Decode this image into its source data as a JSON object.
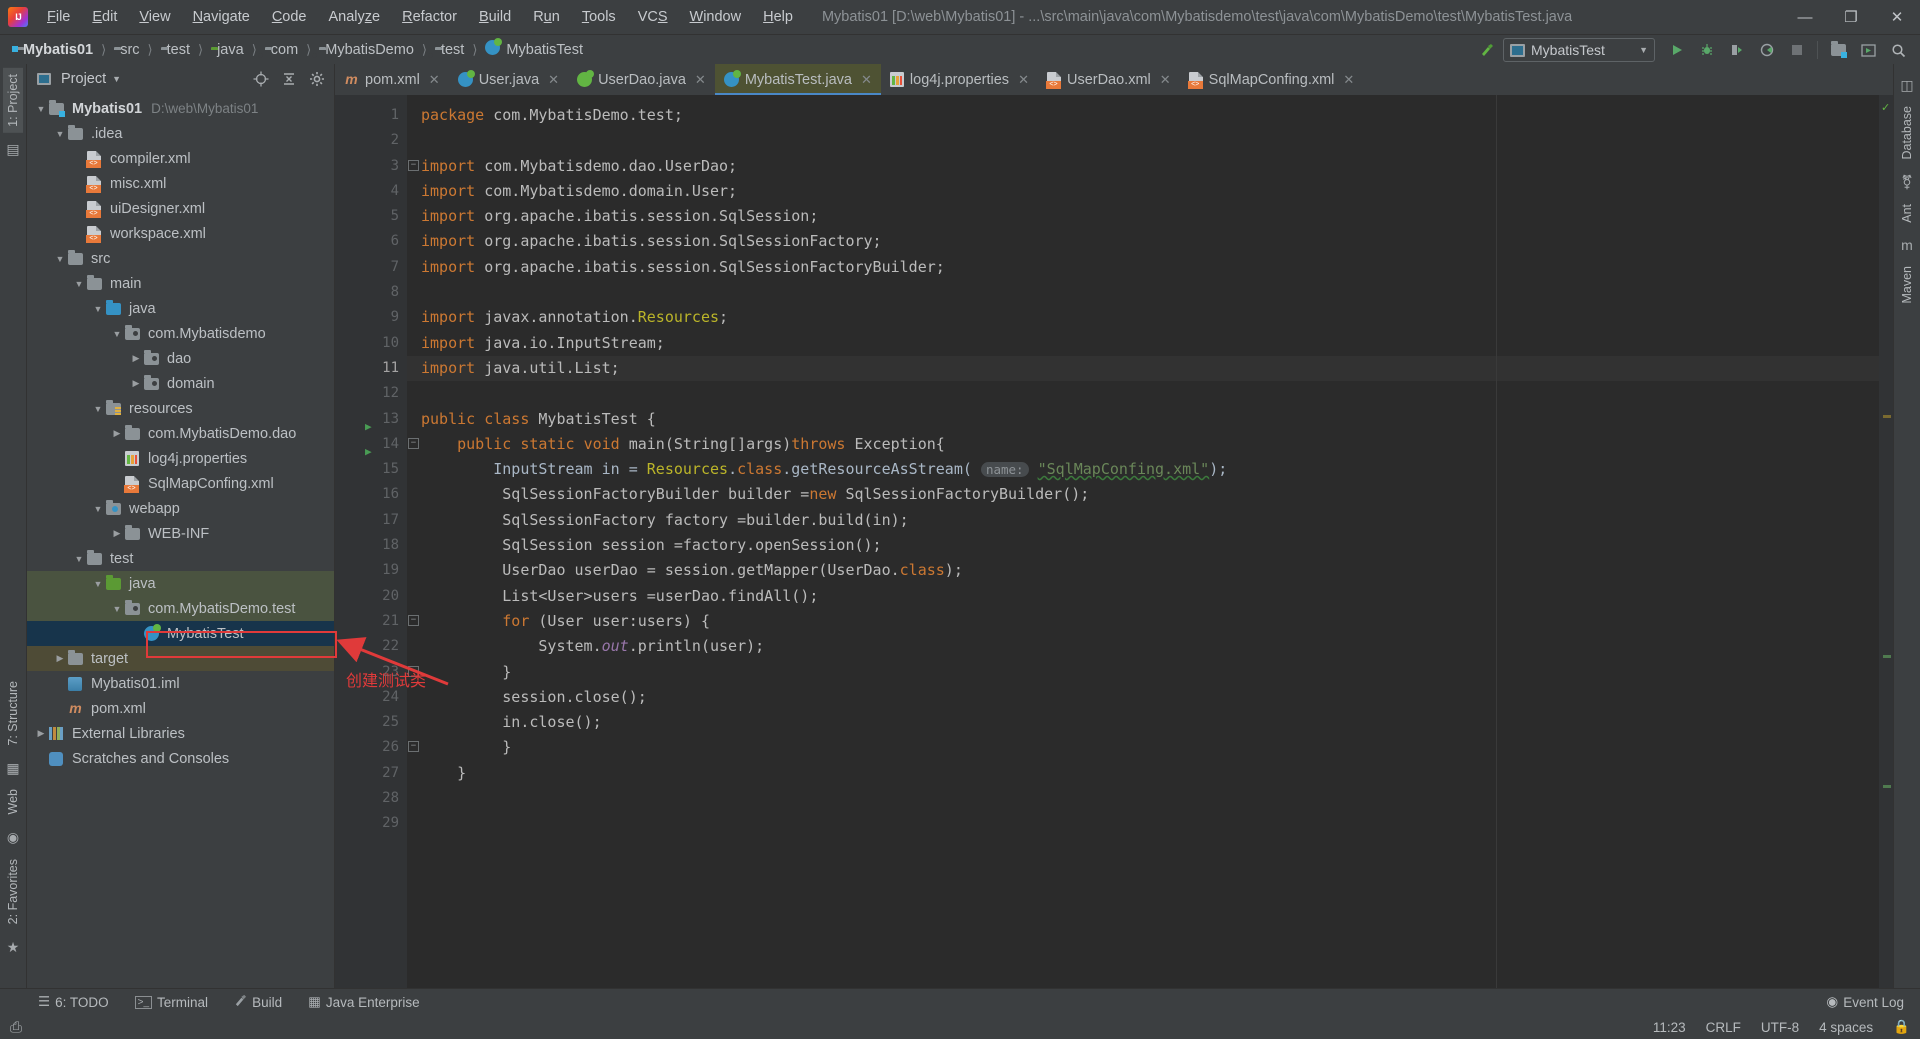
{
  "window": {
    "title": "Mybatis01 [D:\\web\\Mybatis01] - ...\\src\\main\\java\\com\\Mybatisdemo\\test\\java\\com\\MybatisDemo\\test\\MybatisTest.java",
    "minimize": "—",
    "maximize": "❐",
    "close": "✕"
  },
  "menu": [
    {
      "label": "File"
    },
    {
      "label": "Edit"
    },
    {
      "label": "View"
    },
    {
      "label": "Navigate"
    },
    {
      "label": "Code"
    },
    {
      "label": "Analyze"
    },
    {
      "label": "Refactor"
    },
    {
      "label": "Build"
    },
    {
      "label": "Run"
    },
    {
      "label": "Tools"
    },
    {
      "label": "VCS"
    },
    {
      "label": "Window"
    },
    {
      "label": "Help"
    }
  ],
  "breadcrumb": [
    {
      "label": "Mybatis01",
      "icon": "module-folder-icon"
    },
    {
      "label": "src",
      "icon": "folder-icon"
    },
    {
      "label": "test",
      "icon": "folder-icon"
    },
    {
      "label": "java",
      "icon": "source-root-folder-icon"
    },
    {
      "label": "com",
      "icon": "package-icon"
    },
    {
      "label": "MybatisDemo",
      "icon": "package-icon"
    },
    {
      "label": "test",
      "icon": "package-icon"
    },
    {
      "label": "MybatisTest",
      "icon": "java-class-icon"
    }
  ],
  "toolbar": {
    "build_hammer": "build-icon",
    "run_config": "MybatisTest",
    "run": "run-icon",
    "debug": "debug-icon",
    "run_coverage": "run-with-coverage-icon",
    "profile": "profile-icon",
    "stop": "stop-icon",
    "open_project": "open-project-icon",
    "update_project": "update-project-icon",
    "search": "search-everywhere-icon"
  },
  "left_strip": {
    "project_tab": "1: Project",
    "structure_tab": "7: Structure",
    "favorites_tab": "2: Favorites",
    "web_tab": "Web"
  },
  "right_strip": {
    "database_tab": "Database",
    "ant_tab": "Ant",
    "maven_tab": "Maven"
  },
  "project_panel": {
    "title": "Project",
    "dropdown": "▼",
    "locate_icon": "locate-target-icon",
    "collapse_icon": "collapse-all-icon",
    "settings_icon": "gear-icon",
    "tree": [
      {
        "depth": 0,
        "arrow": "down",
        "icon": "module-folder-icon",
        "label": "Mybatis01",
        "bold": true,
        "path": "D:\\web\\Mybatis01",
        "sel": ""
      },
      {
        "depth": 1,
        "arrow": "down",
        "icon": "folder-icon",
        "label": ".idea",
        "sel": ""
      },
      {
        "depth": 2,
        "arrow": "none",
        "icon": "xml-icon",
        "label": "compiler.xml",
        "sel": ""
      },
      {
        "depth": 2,
        "arrow": "none",
        "icon": "xml-icon",
        "label": "misc.xml",
        "sel": ""
      },
      {
        "depth": 2,
        "arrow": "none",
        "icon": "xml-icon",
        "label": "uiDesigner.xml",
        "sel": ""
      },
      {
        "depth": 2,
        "arrow": "none",
        "icon": "xml-icon",
        "label": "workspace.xml",
        "sel": ""
      },
      {
        "depth": 1,
        "arrow": "down",
        "icon": "folder-icon",
        "label": "src",
        "sel": ""
      },
      {
        "depth": 2,
        "arrow": "down",
        "icon": "folder-icon",
        "label": "main",
        "sel": ""
      },
      {
        "depth": 3,
        "arrow": "down",
        "icon": "source-root-blue-icon",
        "label": "java",
        "sel": ""
      },
      {
        "depth": 4,
        "arrow": "down",
        "icon": "package-icon",
        "label": "com.Mybatisdemo",
        "sel": ""
      },
      {
        "depth": 5,
        "arrow": "right",
        "icon": "package-icon",
        "label": "dao",
        "sel": ""
      },
      {
        "depth": 5,
        "arrow": "right",
        "icon": "package-icon",
        "label": "domain",
        "sel": ""
      },
      {
        "depth": 3,
        "arrow": "down",
        "icon": "resources-folder-icon",
        "label": "resources",
        "sel": ""
      },
      {
        "depth": 4,
        "arrow": "right",
        "icon": "folder-icon",
        "label": "com.MybatisDemo.dao",
        "sel": ""
      },
      {
        "depth": 4,
        "arrow": "none",
        "icon": "properties-icon",
        "label": "log4j.properties",
        "sel": ""
      },
      {
        "depth": 4,
        "arrow": "none",
        "icon": "xml-icon",
        "label": "SqlMapConfing.xml",
        "sel": ""
      },
      {
        "depth": 3,
        "arrow": "down",
        "icon": "webapp-folder-icon",
        "label": "webapp",
        "sel": ""
      },
      {
        "depth": 4,
        "arrow": "right",
        "icon": "folder-icon",
        "label": "WEB-INF",
        "sel": ""
      },
      {
        "depth": 2,
        "arrow": "down",
        "icon": "folder-icon",
        "label": "test",
        "sel": ""
      },
      {
        "depth": 3,
        "arrow": "down",
        "icon": "test-source-root-icon",
        "label": "java",
        "sel": "sel-green"
      },
      {
        "depth": 4,
        "arrow": "down",
        "icon": "package-icon",
        "label": "com.MybatisDemo.test",
        "sel": "sel-green"
      },
      {
        "depth": 5,
        "arrow": "none",
        "icon": "java-class-icon",
        "label": "MybatisTest",
        "sel": "sel-blue",
        "highlight": true
      },
      {
        "depth": 1,
        "arrow": "right",
        "icon": "target-folder-icon",
        "label": "target",
        "sel": "sel-olive"
      },
      {
        "depth": 1,
        "arrow": "none",
        "icon": "iml-icon",
        "label": "Mybatis01.iml",
        "sel": ""
      },
      {
        "depth": 1,
        "arrow": "none",
        "icon": "maven-icon",
        "label": "pom.xml",
        "sel": ""
      },
      {
        "depth": 0,
        "arrow": "right",
        "icon": "external-libraries-icon",
        "label": "External Libraries",
        "sel": ""
      },
      {
        "depth": 0,
        "arrow": "none",
        "icon": "scratches-icon",
        "label": "Scratches and Consoles",
        "sel": ""
      }
    ]
  },
  "editor": {
    "tabs": [
      {
        "label": "pom.xml",
        "icon": "maven-icon",
        "active": false
      },
      {
        "label": "User.java",
        "icon": "java-class-icon",
        "active": false
      },
      {
        "label": "UserDao.java",
        "icon": "java-interface-icon",
        "active": false
      },
      {
        "label": "MybatisTest.java",
        "icon": "java-class-icon",
        "active": true
      },
      {
        "label": "log4j.properties",
        "icon": "properties-icon",
        "active": false
      },
      {
        "label": "UserDao.xml",
        "icon": "xml-icon",
        "active": false
      },
      {
        "label": "SqlMapConfing.xml",
        "icon": "xml-icon",
        "active": false
      }
    ],
    "close_glyph": "✕",
    "lines": [
      {
        "n": 1,
        "hl": false,
        "fold": "",
        "run": false
      },
      {
        "n": 2,
        "hl": false,
        "fold": "",
        "run": false
      },
      {
        "n": 3,
        "hl": false,
        "fold": "minus-top",
        "run": false
      },
      {
        "n": 4,
        "hl": false,
        "fold": "",
        "run": false
      },
      {
        "n": 5,
        "hl": false,
        "fold": "",
        "run": false
      },
      {
        "n": 6,
        "hl": false,
        "fold": "",
        "run": false
      },
      {
        "n": 7,
        "hl": false,
        "fold": "",
        "run": false
      },
      {
        "n": 8,
        "hl": false,
        "fold": "",
        "run": false
      },
      {
        "n": 9,
        "hl": false,
        "fold": "",
        "run": false
      },
      {
        "n": 10,
        "hl": false,
        "fold": "",
        "run": false
      },
      {
        "n": 11,
        "hl": true,
        "fold": "minus-bottom",
        "run": false
      },
      {
        "n": 12,
        "hl": false,
        "fold": "",
        "run": false
      },
      {
        "n": 13,
        "hl": false,
        "fold": "",
        "run": true
      },
      {
        "n": 14,
        "hl": false,
        "fold": "minus-top",
        "run": true
      },
      {
        "n": 15,
        "hl": false,
        "fold": "",
        "run": false
      },
      {
        "n": 16,
        "hl": false,
        "fold": "",
        "run": false
      },
      {
        "n": 17,
        "hl": false,
        "fold": "",
        "run": false
      },
      {
        "n": 18,
        "hl": false,
        "fold": "",
        "run": false
      },
      {
        "n": 19,
        "hl": false,
        "fold": "",
        "run": false
      },
      {
        "n": 20,
        "hl": false,
        "fold": "",
        "run": false
      },
      {
        "n": 21,
        "hl": false,
        "fold": "minus-top",
        "run": false
      },
      {
        "n": 22,
        "hl": false,
        "fold": "",
        "run": false
      },
      {
        "n": 23,
        "hl": false,
        "fold": "minus-bottom",
        "run": false
      },
      {
        "n": 24,
        "hl": false,
        "fold": "",
        "run": false
      },
      {
        "n": 25,
        "hl": false,
        "fold": "",
        "run": false
      },
      {
        "n": 26,
        "hl": false,
        "fold": "minus-bottom",
        "run": false
      },
      {
        "n": 27,
        "hl": false,
        "fold": "",
        "run": false
      },
      {
        "n": 28,
        "hl": false,
        "fold": "",
        "run": false
      },
      {
        "n": 29,
        "hl": false,
        "fold": "",
        "run": false
      }
    ],
    "code_text": [
      "package com.MybatisDemo.test;",
      "",
      "import com.Mybatisdemo.dao.UserDao;",
      "import com.Mybatisdemo.domain.User;",
      "import org.apache.ibatis.session.SqlSession;",
      "import org.apache.ibatis.session.SqlSessionFactory;",
      "import org.apache.ibatis.session.SqlSessionFactoryBuilder;",
      "",
      "import javax.annotation.Resources;",
      "import java.io.InputStream;",
      "import java.util.List;",
      "",
      "public class MybatisTest {",
      "    public static void main(String[]args)throws Exception{",
      "        InputStream in = Resources.class.getResourceAsStream( name: \"SqlMapConfing.xml\");",
      "         SqlSessionFactoryBuilder builder =new SqlSessionFactoryBuilder();",
      "         SqlSessionFactory factory =builder.build(in);",
      "         SqlSession session =factory.openSession();",
      "         UserDao userDao = session.getMapper(UserDao.class);",
      "         List<User>users =userDao.findAll();",
      "         for (User user:users) {",
      "             System.out.println(user);",
      "         }",
      "         session.close();",
      "         in.close();",
      "         }",
      "    }",
      "",
      ""
    ],
    "inlay_hint": "name:"
  },
  "annotations": {
    "callout_text": "创建测试类",
    "box_color": "#e03a3a"
  },
  "bottom_bar": {
    "items": [
      {
        "label": "6: TODO",
        "icon": "todo-icon",
        "mnemonic": "6"
      },
      {
        "label": "Terminal",
        "icon": "terminal-icon"
      },
      {
        "label": "Build",
        "icon": "build-hammer-icon"
      },
      {
        "label": "Java Enterprise",
        "icon": "java-enterprise-icon"
      }
    ],
    "event_log": "Event Log"
  },
  "status_bar": {
    "position": "11:23",
    "line_separator": "CRLF",
    "encoding": "UTF-8",
    "indent": "4 spaces",
    "lock_icon": "lock-icon"
  }
}
